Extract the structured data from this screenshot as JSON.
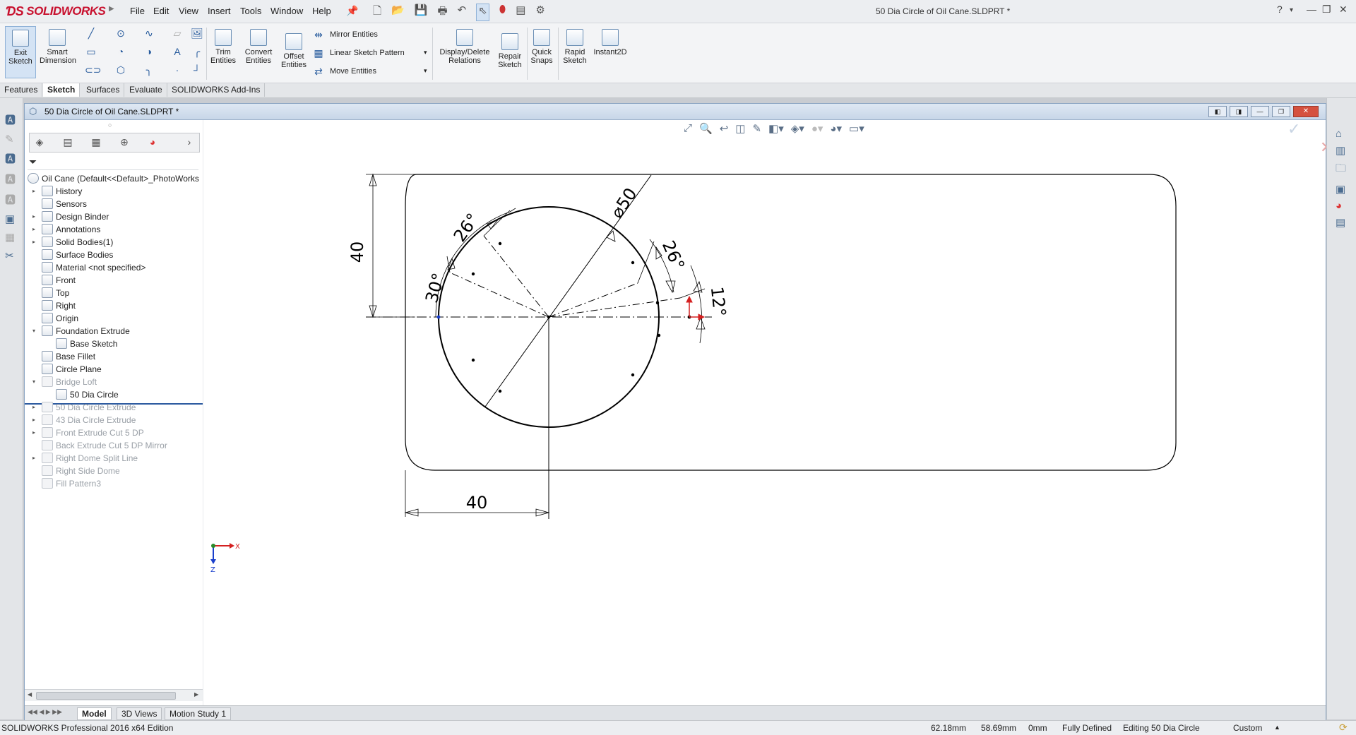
{
  "app": {
    "brand": "SOLIDWORKS",
    "document_title": "50 Dia Circle of Oil Cane.SLDPRT *",
    "menu": [
      "File",
      "Edit",
      "View",
      "Insert",
      "Tools",
      "Window",
      "Help"
    ],
    "window_controls": [
      "?",
      "▾",
      "—",
      "❐",
      "✕"
    ]
  },
  "command_manager": {
    "exit_sketch": "Exit Sketch",
    "smart_dimension": "Smart Dimension",
    "trim_entities": "Trim Entities",
    "convert_entities": "Convert Entities",
    "offset_entities": "Offset Entities",
    "mirror_entities": "Mirror Entities",
    "linear_sketch_pattern": "Linear Sketch Pattern",
    "move_entities": "Move Entities",
    "display_delete_relations": "Display/Delete Relations",
    "repair_sketch": "Repair Sketch",
    "quick_snaps": "Quick Snaps",
    "rapid_sketch": "Rapid Sketch",
    "instant2d": "Instant2D"
  },
  "tabs": [
    "Features",
    "Sketch",
    "Surfaces",
    "Evaluate",
    "SOLIDWORKS Add-Ins"
  ],
  "active_tab": "Sketch",
  "feature_manager": {
    "root": "Oil Cane  (Default<<Default>_PhotoWorks",
    "nodes": [
      {
        "label": "History",
        "indent": 0,
        "expander": "▸",
        "dim": false
      },
      {
        "label": "Sensors",
        "indent": 0,
        "expander": "",
        "dim": false
      },
      {
        "label": "Design Binder",
        "indent": 0,
        "expander": "▸",
        "dim": false
      },
      {
        "label": "Annotations",
        "indent": 0,
        "expander": "▸",
        "dim": false
      },
      {
        "label": "Solid Bodies(1)",
        "indent": 0,
        "expander": "▸",
        "dim": false
      },
      {
        "label": "Surface Bodies",
        "indent": 0,
        "expander": "",
        "dim": false
      },
      {
        "label": "Material <not specified>",
        "indent": 0,
        "expander": "",
        "dim": false
      },
      {
        "label": "Front",
        "indent": 0,
        "expander": "",
        "dim": false
      },
      {
        "label": "Top",
        "indent": 0,
        "expander": "",
        "dim": false
      },
      {
        "label": "Right",
        "indent": 0,
        "expander": "",
        "dim": false
      },
      {
        "label": "Origin",
        "indent": 0,
        "expander": "",
        "dim": false
      },
      {
        "label": "Foundation Extrude",
        "indent": 0,
        "expander": "▾",
        "dim": false
      },
      {
        "label": "Base Sketch",
        "indent": 1,
        "expander": "",
        "dim": false
      },
      {
        "label": "Base Fillet",
        "indent": 0,
        "expander": "",
        "dim": false
      },
      {
        "label": "Circle Plane",
        "indent": 0,
        "expander": "",
        "dim": false
      },
      {
        "label": "Bridge Loft",
        "indent": 0,
        "expander": "▾",
        "dim": true
      },
      {
        "label": "50 Dia Circle",
        "indent": 1,
        "expander": "",
        "dim": false
      },
      {
        "label": "50 Dia Circle Extrude",
        "indent": 0,
        "expander": "▸",
        "dim": true
      },
      {
        "label": "43 Dia Circle Extrude",
        "indent": 0,
        "expander": "▸",
        "dim": true
      },
      {
        "label": "Front Extrude Cut 5 DP",
        "indent": 0,
        "expander": "▸",
        "dim": true
      },
      {
        "label": "Back Extrude Cut 5 DP Mirror",
        "indent": 0,
        "expander": "",
        "dim": true
      },
      {
        "label": "Right Dome Split Line",
        "indent": 0,
        "expander": "▸",
        "dim": true
      },
      {
        "label": "Right Side Dome",
        "indent": 0,
        "expander": "",
        "dim": true
      },
      {
        "label": "Fill Pattern3",
        "indent": 0,
        "expander": "",
        "dim": true
      }
    ]
  },
  "sketch": {
    "dim_height": "40",
    "dim_width": "40",
    "dim_diameter": "⌀50",
    "angle_30": "30°",
    "angle_26_left": "26°",
    "angle_26_right": "26°",
    "angle_12": "12°",
    "triad_x": "X",
    "triad_z": "Z"
  },
  "bottom_tabs": [
    "Model",
    "3D Views",
    "Motion Study 1"
  ],
  "active_bottom_tab": "Model",
  "status": {
    "edition": "SOLIDWORKS Professional 2016 x64 Edition",
    "x": "62.18mm",
    "y": "58.69mm",
    "z": "0mm",
    "state": "Fully Defined",
    "editing": "Editing 50 Dia Circle",
    "units": "Custom"
  },
  "colors": {
    "brand_red": "#c8102e",
    "accent_blue": "#2c5aa0",
    "sketch_line": "#000000"
  }
}
